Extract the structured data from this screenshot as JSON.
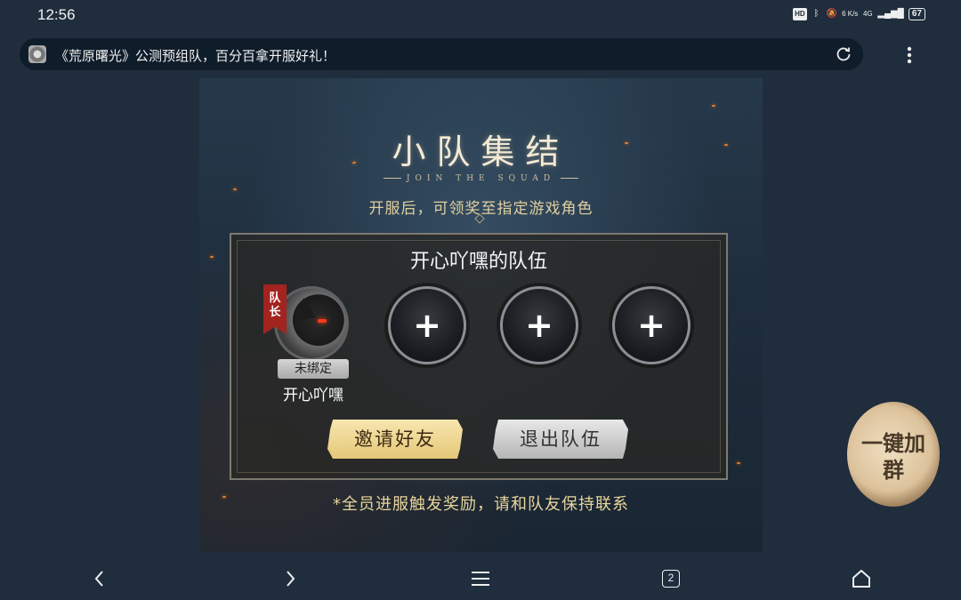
{
  "status_bar": {
    "time": "12:56",
    "icons": [
      "hd-icon",
      "bluetooth-icon",
      "mute-icon",
      "network-speed",
      "signal-icon",
      "battery-icon"
    ],
    "network_speed": "6 K/s",
    "network_type": "4G",
    "battery": "67"
  },
  "browser": {
    "page_title": "《荒原曙光》公测预组队，百分百拿开服好礼！",
    "tab_count": "2"
  },
  "page": {
    "heading": "小队集结",
    "subheading": "JOIN THE SQUAD",
    "notice": "开服后，可领奖至指定游戏角色",
    "team": {
      "name": "开心吖嘿的队伍",
      "leader": {
        "badge": "队长",
        "status": "未绑定",
        "name": "开心吖嘿"
      },
      "empty_slots": [
        "+",
        "+",
        "+"
      ]
    },
    "buttons": {
      "invite": "邀请好友",
      "leave": "退出队伍"
    },
    "footer_note": "*全员进服触发奖励，请和队友保持联系"
  },
  "floating": {
    "join_group": "一键加群"
  },
  "colors": {
    "background": "#1f2d3d",
    "gold_text": "#e8d59c",
    "invite_button": "#e5c777",
    "leave_button": "#b5b5b5",
    "captain_ribbon": "#a3231f"
  }
}
